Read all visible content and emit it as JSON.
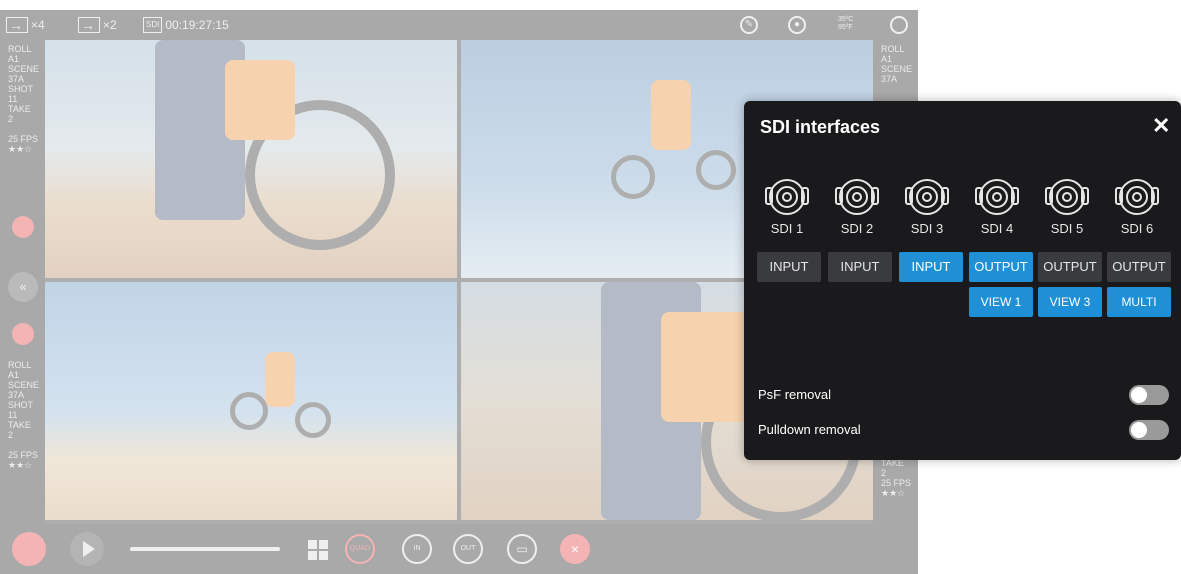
{
  "topbar": {
    "out4": "×4",
    "out2": "×2",
    "sdi_badge": "SDI",
    "timecode": "00:19:27:15",
    "temp_c": "35ºC",
    "temp_f": "95ºF"
  },
  "meta": {
    "roll_label": "ROLL",
    "roll": "A1",
    "scene_label": "SCENE",
    "scene": "37A",
    "shot_label": "SHOT",
    "shot": "11",
    "take_label": "TAKE",
    "take": "2",
    "fps": "25 FPS",
    "rating": "★★☆"
  },
  "bottombar": {
    "quad": "QUAD",
    "in": "IN",
    "out": "OUT"
  },
  "dialog": {
    "title": "SDI interfaces",
    "close": "✕",
    "ports": [
      {
        "label": "SDI 1",
        "mode": "INPUT",
        "active": false
      },
      {
        "label": "SDI 2",
        "mode": "INPUT",
        "active": false
      },
      {
        "label": "SDI 3",
        "mode": "INPUT",
        "active": true
      },
      {
        "label": "SDI 4",
        "mode": "OUTPUT",
        "active": true,
        "view": "VIEW 1"
      },
      {
        "label": "SDI 5",
        "mode": "OUTPUT",
        "active": false,
        "view": "VIEW 3"
      },
      {
        "label": "SDI 6",
        "mode": "OUTPUT",
        "active": false,
        "view": "MULTI"
      }
    ],
    "psf_label": "PsF removal",
    "pulldown_label": "Pulldown removal",
    "psf_on": false,
    "pulldown_on": false
  },
  "colors": {
    "accent": "#1f8fd6",
    "record": "#e23b3b",
    "dialog_bg": "#1a1a1c"
  }
}
